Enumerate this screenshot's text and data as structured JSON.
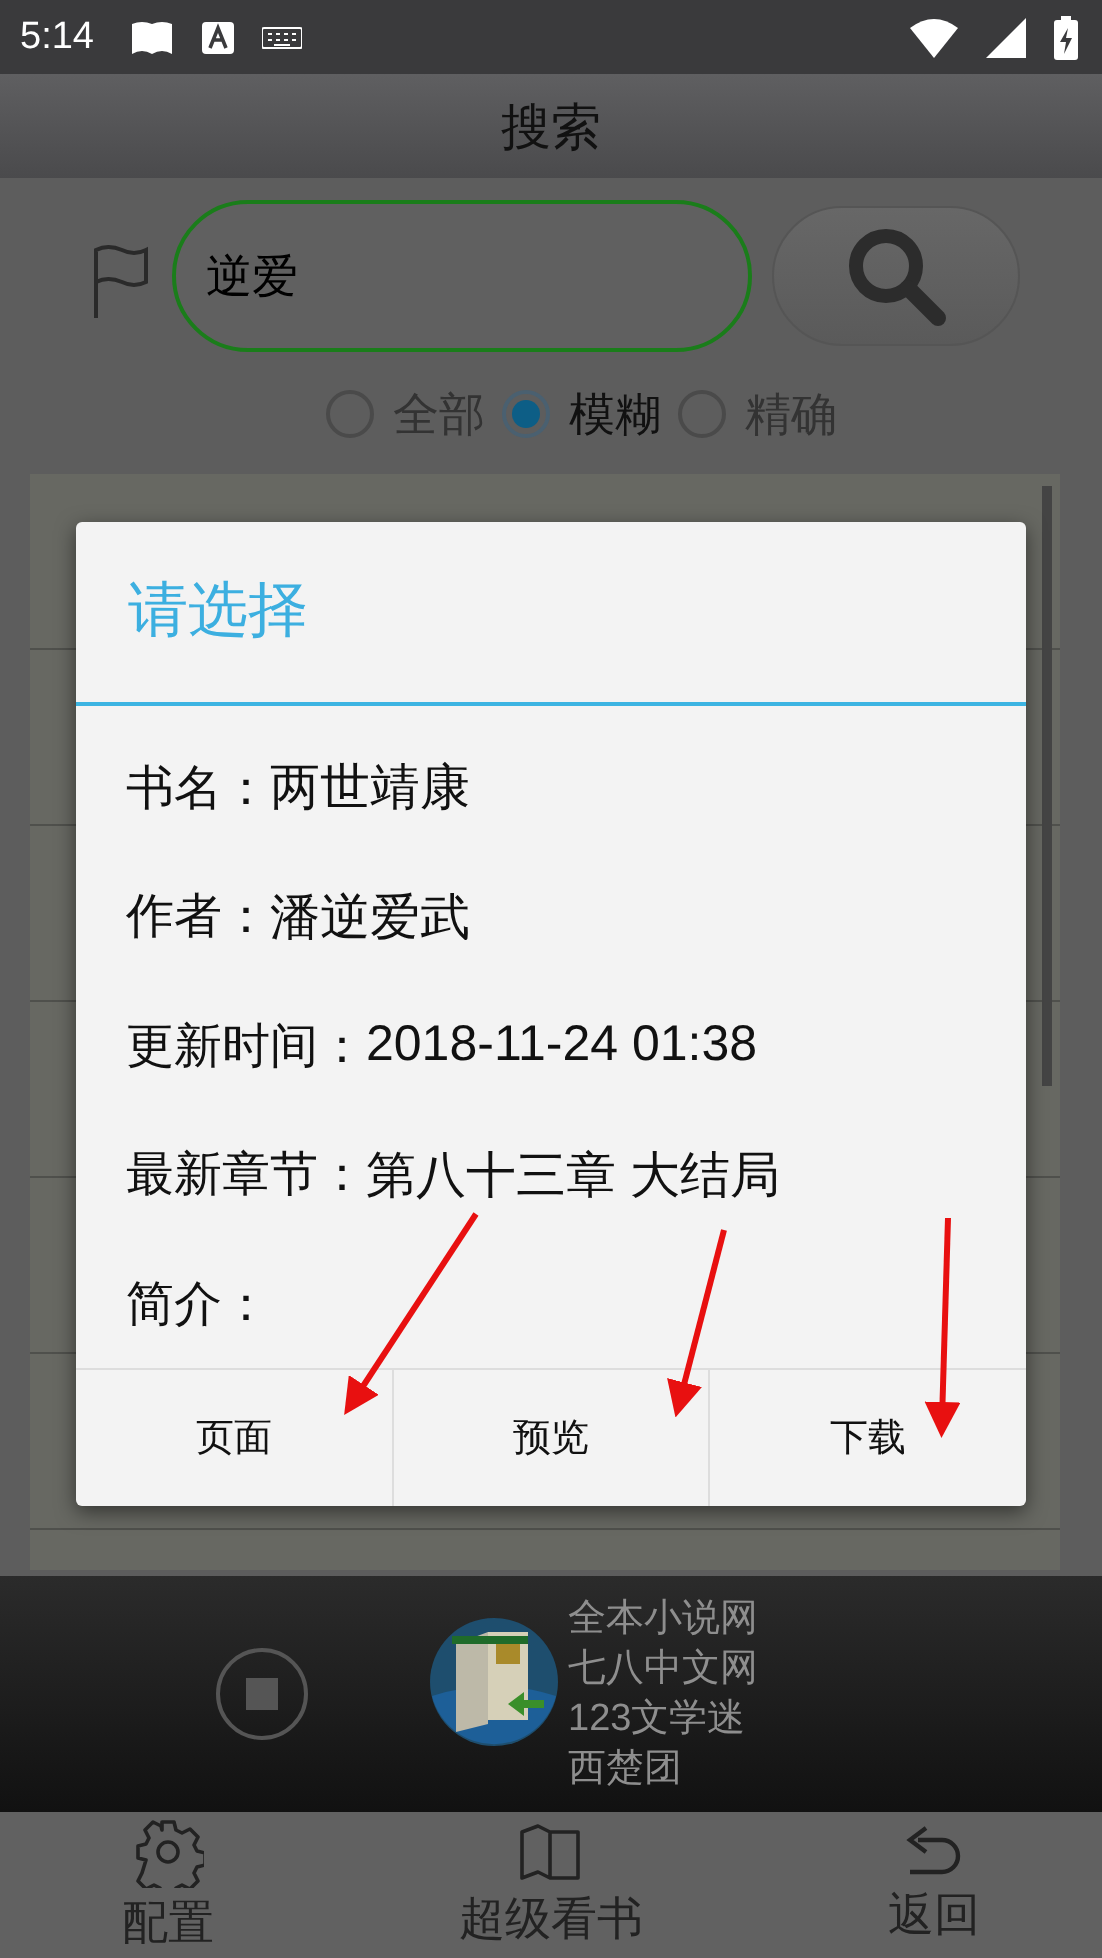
{
  "status_bar": {
    "time": "5:14"
  },
  "title": "搜索",
  "search": {
    "value": "逆爱"
  },
  "match_modes": [
    {
      "label": "全部",
      "selected": false
    },
    {
      "label": "模糊",
      "selected": true
    },
    {
      "label": "精确",
      "selected": false
    }
  ],
  "dialog": {
    "title": "请选择",
    "fields": [
      {
        "label": "书名：",
        "value": "两世靖康"
      },
      {
        "label": "作者：",
        "value": "潘逆爱武"
      },
      {
        "label": "更新时间：",
        "value": "2018-11-24 01:38"
      },
      {
        "label": "最新章节：",
        "value": "第八十三章  大结局"
      },
      {
        "label": "简介："
      }
    ],
    "buttons": [
      "页面",
      "预览",
      "下载"
    ]
  },
  "sources": [
    "全本小说网",
    "七八中文网",
    "123文学迷",
    "西楚团"
  ],
  "nav": [
    {
      "label": "配置"
    },
    {
      "label": "超级看书"
    },
    {
      "label": "返回"
    }
  ]
}
